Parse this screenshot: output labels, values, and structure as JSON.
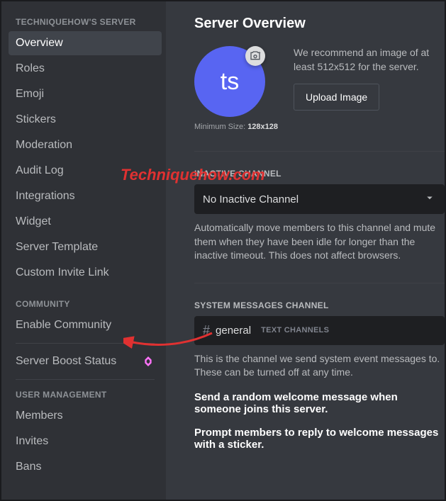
{
  "sidebar": {
    "header1": "TECHNIQUEHOW'S SERVER",
    "items1": [
      {
        "label": "Overview",
        "active": true
      },
      {
        "label": "Roles"
      },
      {
        "label": "Emoji"
      },
      {
        "label": "Stickers"
      },
      {
        "label": "Moderation"
      },
      {
        "label": "Audit Log"
      },
      {
        "label": "Integrations"
      },
      {
        "label": "Widget"
      },
      {
        "label": "Server Template"
      },
      {
        "label": "Custom Invite Link"
      }
    ],
    "header2": "COMMUNITY",
    "items2": [
      {
        "label": "Enable Community"
      }
    ],
    "boost_label": "Server Boost Status",
    "header3": "USER MANAGEMENT",
    "items3": [
      {
        "label": "Members"
      },
      {
        "label": "Invites"
      },
      {
        "label": "Bans"
      }
    ]
  },
  "content": {
    "title": "Server Overview",
    "avatar_initials": "ts",
    "minsize_prefix": "Minimum Size: ",
    "minsize_value": "128x128",
    "recommend": "We recommend an image of at least 512x512 for the server.",
    "upload_btn": "Upload Image",
    "inactive": {
      "label": "INACTIVE CHANNEL",
      "value": "No Inactive Channel",
      "help": "Automatically move members to this channel and mute them when they have been idle for longer than the inactive timeout. This does not affect browsers."
    },
    "system": {
      "label": "SYSTEM MESSAGES CHANNEL",
      "channel": "general",
      "category": "TEXT CHANNELS",
      "help": "This is the channel we send system event messages to. These can be turned off at any time.",
      "toggle1": "Send a random welcome message when someone joins this server.",
      "toggle2": "Prompt members to reply to welcome messages with a sticker."
    }
  },
  "watermark": "Techniquehow.com"
}
